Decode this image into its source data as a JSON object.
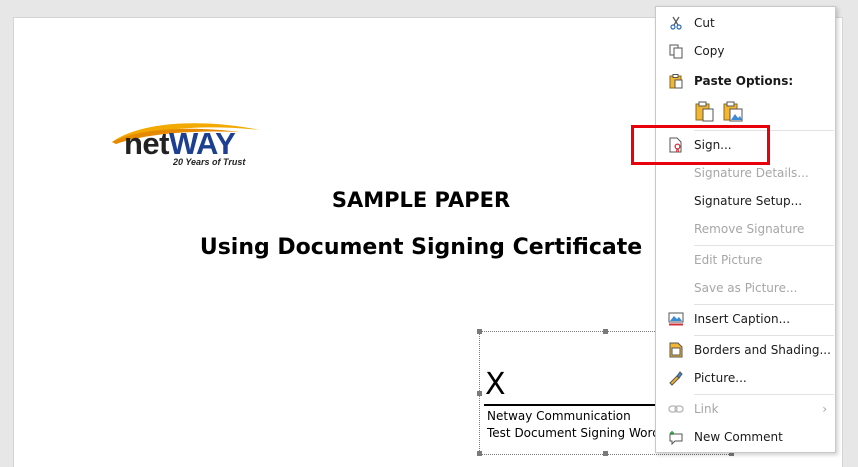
{
  "document": {
    "logo": {
      "brand_left": "net",
      "brand_right": "WAY",
      "tagline": "20 Years of Trust"
    },
    "title": "SAMPLE PAPER",
    "subtitle": "Using Document Signing Certificate",
    "signature": {
      "x_mark": "X",
      "signer_name": "Netway Communication",
      "signer_title": "Test Document Signing Word"
    }
  },
  "context_menu": {
    "cut": "Cut",
    "copy": "Copy",
    "paste_options": "Paste Options:",
    "sign": "Sign...",
    "signature_details": "Signature Details...",
    "signature_setup": "Signature Setup...",
    "remove_signature": "Remove Signature",
    "edit_picture": "Edit Picture",
    "save_as_picture": "Save as Picture...",
    "insert_caption": "Insert Caption...",
    "borders_shading": "Borders and Shading...",
    "picture": "Picture...",
    "link": "Link",
    "new_comment": "New Comment"
  },
  "colors": {
    "highlight": "#e8000b",
    "brand_blue": "#1d3f8f",
    "swoosh": "#f2a900"
  }
}
